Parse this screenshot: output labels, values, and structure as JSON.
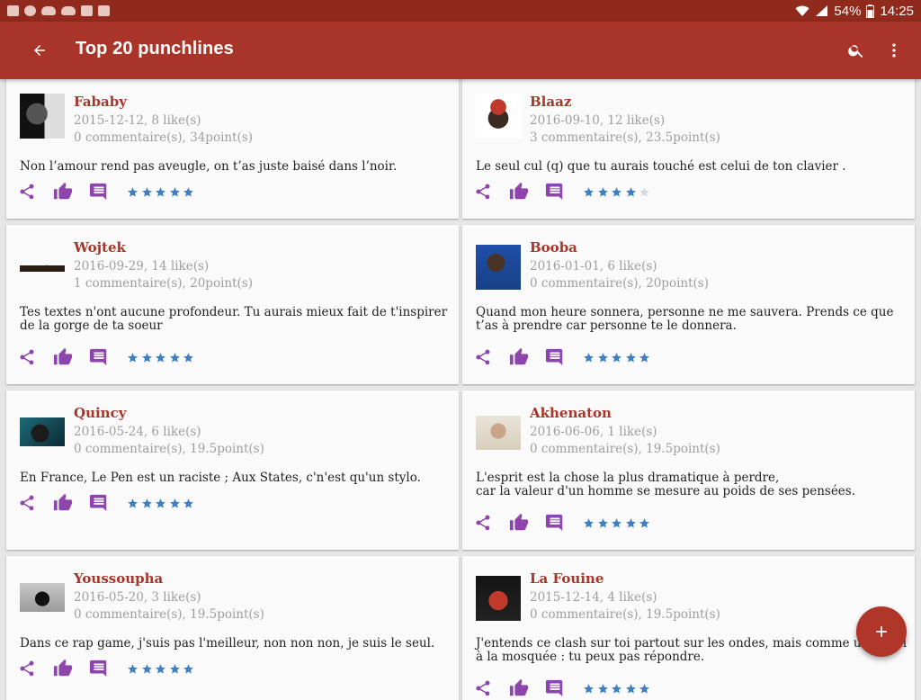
{
  "status_bar": {
    "battery": "54%",
    "time": "14:25"
  },
  "app_bar": {
    "title": "Top 20 punchlines"
  },
  "icons": {
    "back": "arrow-back-icon",
    "search": "search-icon",
    "overflow": "more-vert-icon",
    "share": "share-icon",
    "like": "thumb-up-icon",
    "comment": "comment-icon",
    "star": "star-icon",
    "add": "add-icon"
  },
  "colors": {
    "app_bar": "#a9352a",
    "status_bar": "#8f2a1d",
    "author": "#a9352a",
    "action_icon": "#8e44ad",
    "star_on": "#3f7fbf",
    "star_off": "#d9d9d9"
  },
  "cards": [
    {
      "author": "Fababy",
      "date_likes": "2015-12-12, 8 like(s)",
      "comments_points": "0 commentaire(s), 34point(s)",
      "quote": "Non l’amour rend pas aveugle, on t’as juste baisé dans l’noir.",
      "rating": 5
    },
    {
      "author": "Blaaz",
      "date_likes": "2016-09-10, 12 like(s)",
      "comments_points": "3 commentaire(s), 23.5point(s)",
      "quote": "Le seul cul (q) que tu aurais touché est celui de ton clavier .",
      "rating": 4
    },
    {
      "author": "Wojtek",
      "date_likes": "2016-09-29, 14 like(s)",
      "comments_points": "1 commentaire(s), 20point(s)",
      "quote": "Tes textes n'ont aucune profondeur. Tu aurais mieux fait de t'inspirer\nde la gorge de ta soeur",
      "rating": 5
    },
    {
      "author": "Booba",
      "date_likes": "2016-01-01, 6 like(s)",
      "comments_points": "0 commentaire(s), 20point(s)",
      "quote": "Quand mon heure sonnera, personne ne me sauvera. Prends ce que\nt’as à prendre car personne te le donnera.",
      "rating": 5
    },
    {
      "author": "Quincy",
      "date_likes": "2016-05-24, 6 like(s)",
      "comments_points": "0 commentaire(s), 19.5point(s)",
      "quote": "En France, Le Pen est un raciste ; Aux States, c'n'est qu'un stylo.",
      "rating": 5
    },
    {
      "author": "Akhenaton",
      "date_likes": "2016-06-06, 1 like(s)",
      "comments_points": "0 commentaire(s), 19.5point(s)",
      "quote": "L'esprit est la chose la plus dramatique à perdre,\ncar la valeur d'un homme se mesure au poids de ses pensées.",
      "rating": 5
    },
    {
      "author": "Youssoupha",
      "date_likes": "2016-05-20, 3 like(s)",
      "comments_points": "0 commentaire(s), 19.5point(s)",
      "quote": "Dans ce rap game, j'suis pas l'meilleur, non non non, je suis le seul.",
      "rating": 5
    },
    {
      "author": "La Fouine",
      "date_likes": "2015-12-14, 4 like(s)",
      "comments_points": "0 commentaire(s), 19.5point(s)",
      "quote": "J'entends ce clash sur toi partout sur les ondes, mais comme un appel\nà la mosquée : tu peux pas répondre.",
      "rating": 5
    }
  ]
}
